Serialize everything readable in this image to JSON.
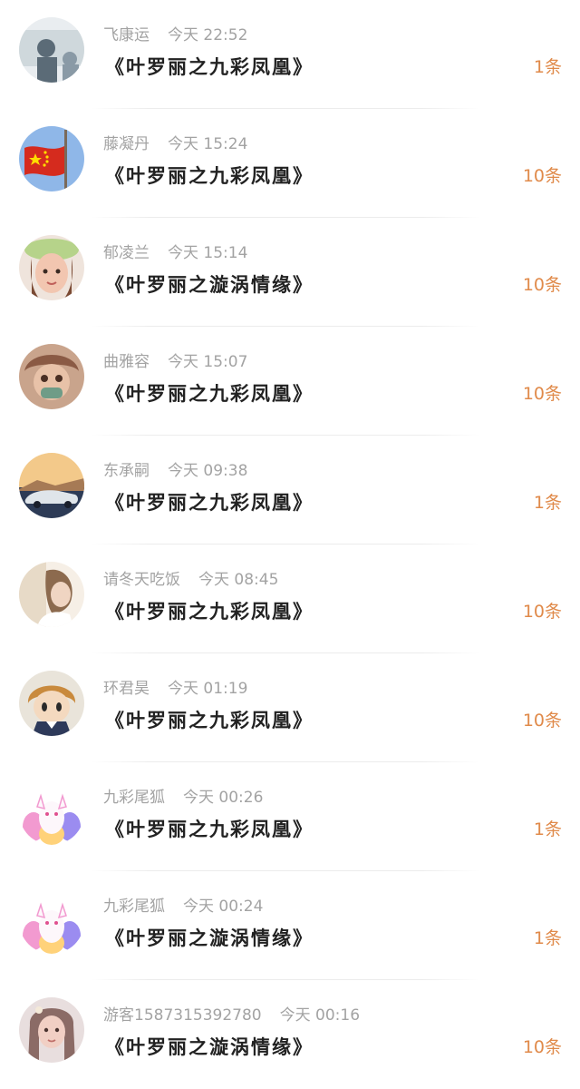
{
  "items": [
    {
      "user": "飞康运",
      "time": "今天 22:52",
      "title": "《叶罗丽之九彩凤凰》",
      "count": "1条",
      "avatar_icon": "photo-avatar-icon",
      "avatar_colors": [
        "#cfd8dc",
        "#5b6b77",
        "#e9edf0"
      ]
    },
    {
      "user": "藤凝丹",
      "time": "今天 15:24",
      "title": "《叶罗丽之九彩凤凰》",
      "count": "10条",
      "avatar_icon": "flag-avatar-icon",
      "avatar_colors": [
        "#8fb7e8",
        "#d52b1e",
        "#ffde00"
      ]
    },
    {
      "user": "郁凌兰",
      "time": "今天 15:14",
      "title": "《叶罗丽之漩涡情缘》",
      "count": "10条",
      "avatar_icon": "girl-avatar-icon",
      "avatar_colors": [
        "#b6d38a",
        "#f2c6b0",
        "#7a4a34"
      ]
    },
    {
      "user": "曲雅容",
      "time": "今天 15:07",
      "title": "《叶罗丽之九彩凤凰》",
      "count": "10条",
      "avatar_icon": "anime-avatar-icon",
      "avatar_colors": [
        "#c9a48c",
        "#8a5a44",
        "#6f9c87"
      ]
    },
    {
      "user": "东承嗣",
      "time": "今天 09:38",
      "title": "《叶罗丽之九彩凤凰》",
      "count": "1条",
      "avatar_icon": "car-avatar-icon",
      "avatar_colors": [
        "#f3c98a",
        "#2d3b56",
        "#dfe5ea"
      ]
    },
    {
      "user": "请冬天吃饭",
      "time": "今天 08:45",
      "title": "《叶罗丽之九彩凤凰》",
      "count": "10条",
      "avatar_icon": "photo-avatar-icon",
      "avatar_colors": [
        "#e7dac7",
        "#8c6a4e",
        "#f6efe6"
      ]
    },
    {
      "user": "环君昊",
      "time": "今天 01:19",
      "title": "《叶罗丽之九彩凤凰》",
      "count": "10条",
      "avatar_icon": "cartoon-avatar-icon",
      "avatar_colors": [
        "#c98a3d",
        "#2e3a5a",
        "#f4d9bf"
      ]
    },
    {
      "user": "九彩尾狐",
      "time": "今天 00:26",
      "title": "《叶罗丽之九彩凤凰》",
      "count": "1条",
      "avatar_icon": "fox-avatar-icon",
      "avatar_colors": [
        "#ffffff",
        "#f29ad0",
        "#9b8cf0"
      ]
    },
    {
      "user": "九彩尾狐",
      "time": "今天 00:24",
      "title": "《叶罗丽之漩涡情缘》",
      "count": "1条",
      "avatar_icon": "fox-avatar-icon",
      "avatar_colors": [
        "#ffffff",
        "#f29ad0",
        "#9b8cf0"
      ]
    },
    {
      "user": "游客1587315392780",
      "time": "今天 00:16",
      "title": "《叶罗丽之漩涡情缘》",
      "count": "10条",
      "avatar_icon": "girl-avatar-icon",
      "avatar_colors": [
        "#e8dede",
        "#f1cfc4",
        "#8b6b66"
      ]
    }
  ],
  "colors": {
    "count": "#e08a4a",
    "meta": "#a3a3a3",
    "title": "#222222",
    "background": "#ffffff"
  }
}
